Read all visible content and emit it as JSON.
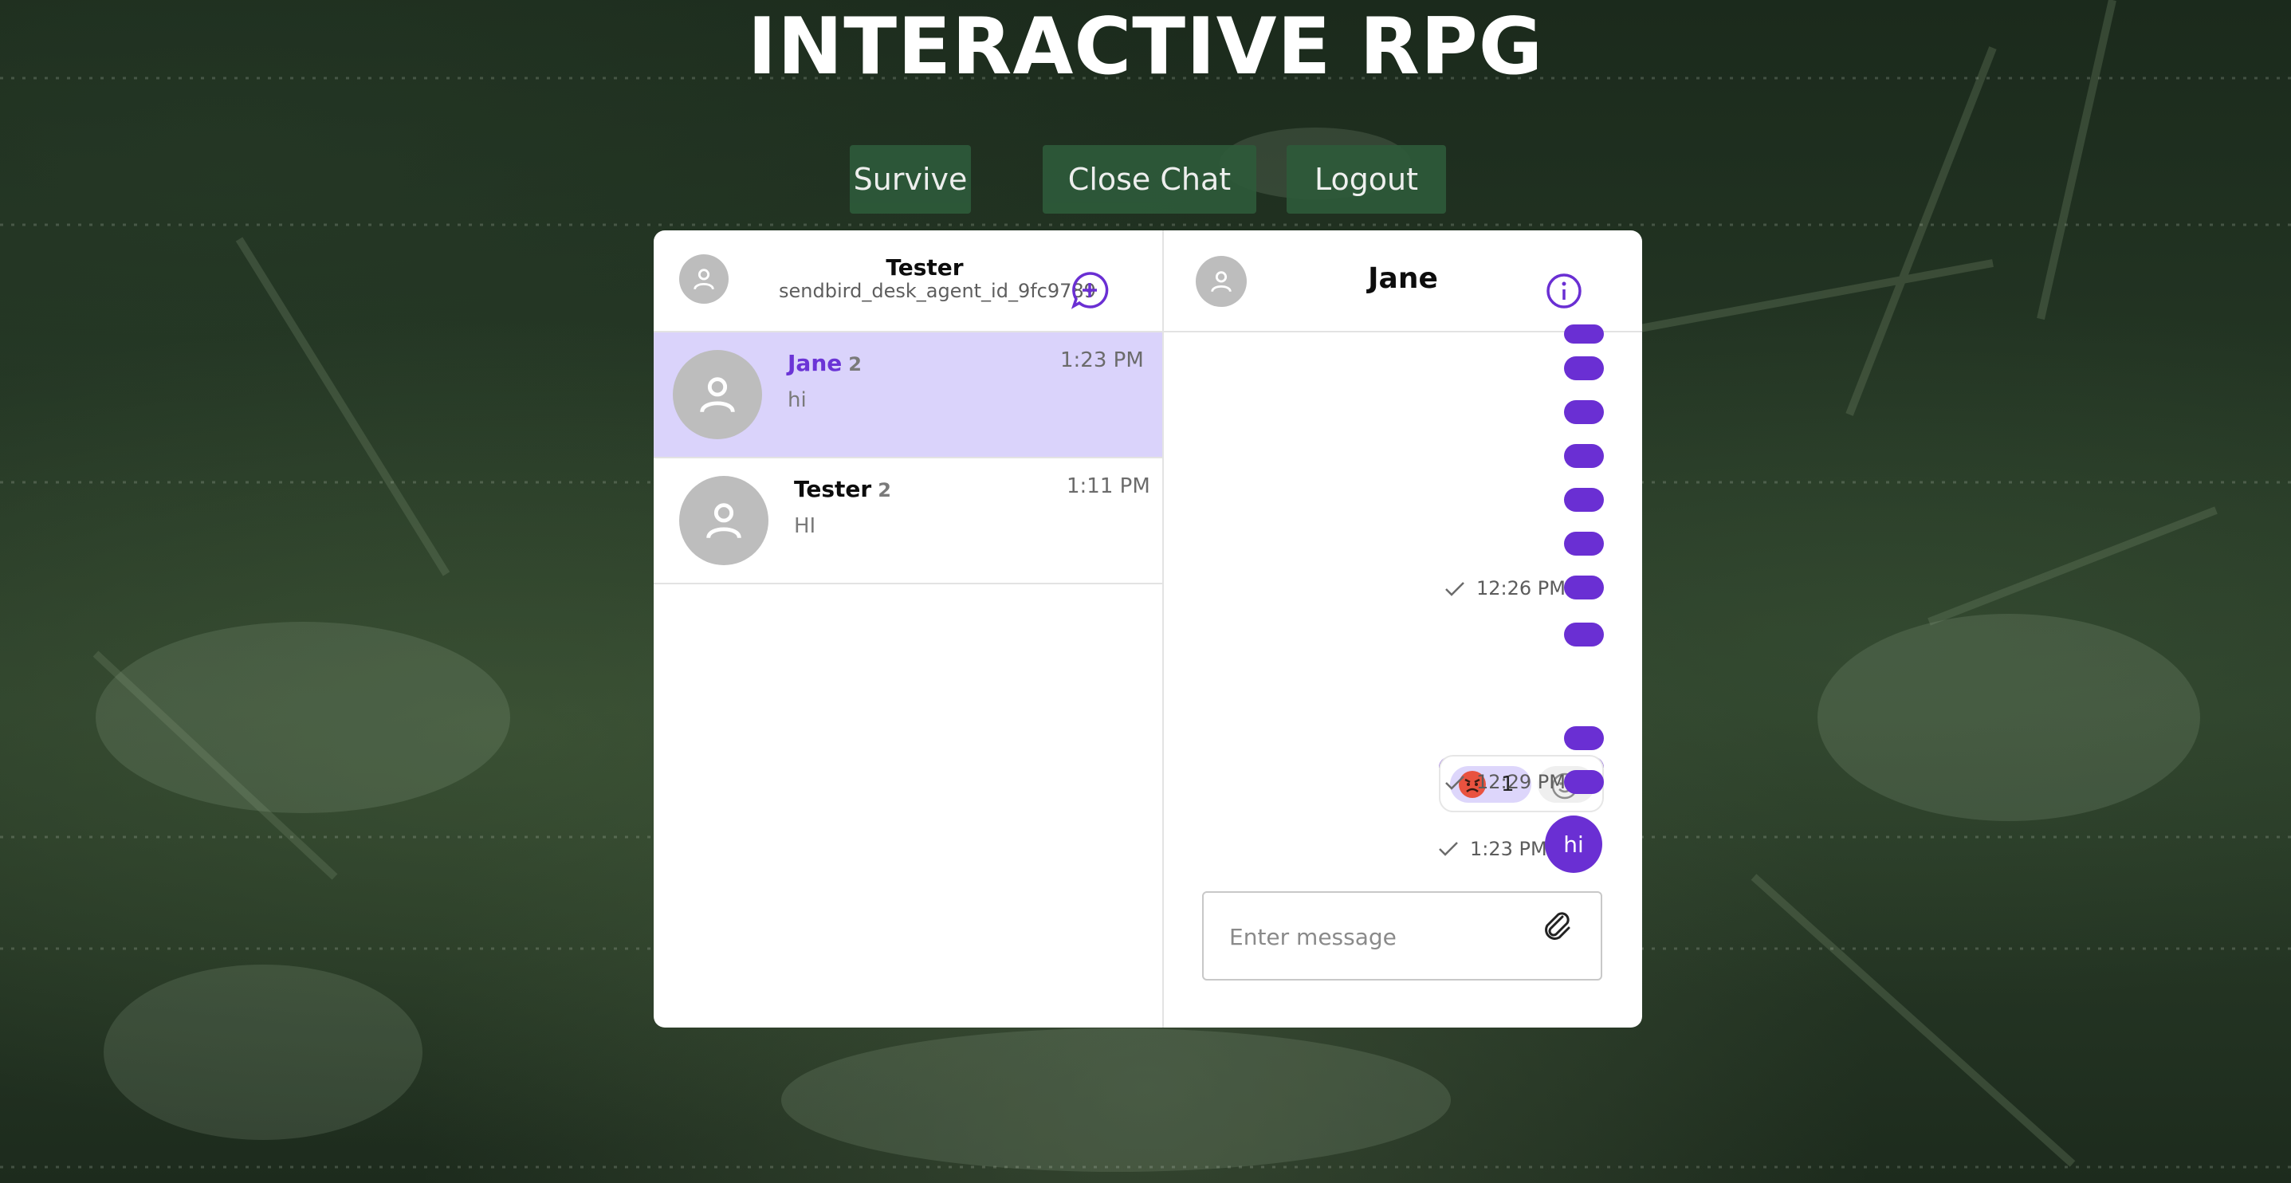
{
  "app": {
    "title": "INTERACTIVE RPG"
  },
  "nav": {
    "survive": "Survive",
    "close_chat": "Close Chat",
    "logout": "Logout"
  },
  "left_header": {
    "name": "Tester",
    "user_id": "sendbird_desk_agent_id_9fc9789"
  },
  "channels": [
    {
      "name": "Jane",
      "member_count": "2",
      "time": "1:23 PM",
      "last_message": "hi"
    },
    {
      "name": "Tester",
      "member_count": "2",
      "time": "1:11 PM",
      "last_message": "HI"
    }
  ],
  "chat": {
    "title": "Jane",
    "timestamps": [
      "12:26 PM",
      "12:29 PM",
      "1:23 PM"
    ],
    "reaction": {
      "emoji": "angry-face",
      "count": "1"
    },
    "last_message": "hi",
    "input": {
      "placeholder": "Enter message",
      "value": ""
    }
  },
  "colors": {
    "accent": "#6a2fd3",
    "active_channel_bg": "#dad3fb",
    "nav_button_bg": "#2e5a3a",
    "reaction_emoji": "#e9523f"
  },
  "icons": [
    "user-avatar-icon",
    "new-chat-icon",
    "info-icon",
    "check-icon",
    "angry-emoji-icon",
    "add-reaction-icon",
    "attachment-icon"
  ]
}
